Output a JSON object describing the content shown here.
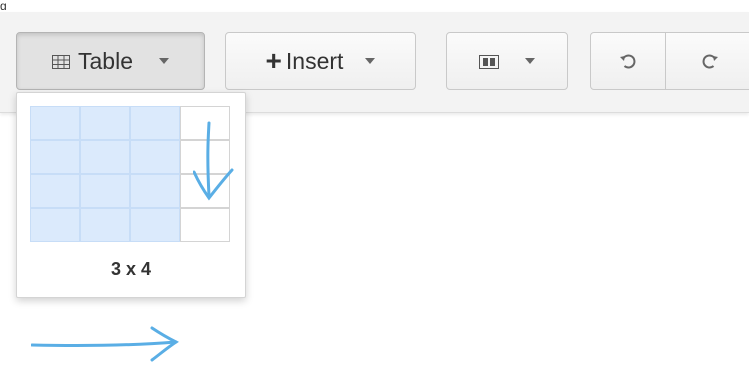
{
  "top_partial_text": "g",
  "toolbar": {
    "table_label": "Table",
    "insert_label": "Insert",
    "icons": {
      "table": "table-grid-icon",
      "insert": "plus-icon",
      "layout": "columns-layout-icon",
      "undo": "undo-icon",
      "redo": "redo-icon",
      "dropdown": "caret-down-icon"
    }
  },
  "table_picker": {
    "size_label": "3 x 4",
    "columns_total": 4,
    "rows_total": 4,
    "selected_columns": 3,
    "selected_rows": 4
  },
  "colors": {
    "selection_fill": "#dbeafc",
    "annotation_arrow": "#5aaee5"
  }
}
